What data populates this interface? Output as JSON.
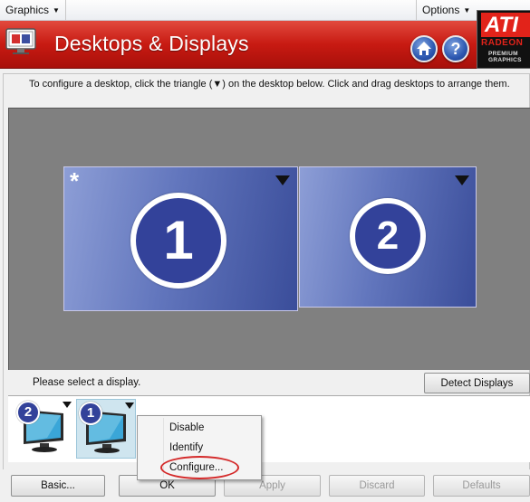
{
  "menubar": {
    "graphics_label": "Graphics",
    "options_label": "Options"
  },
  "header": {
    "title": "Desktops & Displays",
    "home_icon": "home-icon",
    "help_icon": "help-icon",
    "logo": {
      "brand": "ATI",
      "product": "RADEON",
      "tagline": "PREMIUM GRAPHICS",
      "brand_color": "#e2231a"
    },
    "band_color": "#c81a12"
  },
  "instruction": "To configure a desktop, click the triangle (▼) on the desktop below.  Click and drag desktops to arrange them.",
  "desktops": [
    {
      "number": "1",
      "primary_marker": "*"
    },
    {
      "number": "2"
    }
  ],
  "select_prompt": "Please select a display.",
  "detect_button": "Detect Displays",
  "displays": [
    {
      "number": "2"
    },
    {
      "number": "1",
      "selected": true
    }
  ],
  "context_menu": {
    "items": [
      "Disable",
      "Identify",
      "Configure..."
    ]
  },
  "buttons": {
    "basic": "Basic...",
    "ok": "OK",
    "apply": "Apply",
    "discard": "Discard",
    "defaults": "Defaults"
  },
  "colors": {
    "desktop_number_bg": "#33429a",
    "highlight_ring": "#d42a2a"
  }
}
